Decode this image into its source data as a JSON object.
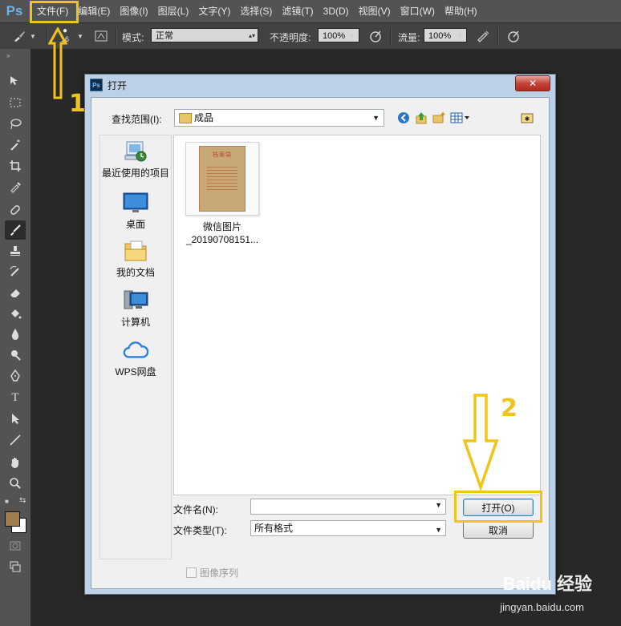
{
  "app": {
    "logo": "Ps"
  },
  "menu": [
    "文件(F)",
    "编辑(E)",
    "图像(I)",
    "图层(L)",
    "文字(Y)",
    "选择(S)",
    "滤镜(T)",
    "3D(D)",
    "视图(V)",
    "窗口(W)",
    "帮助(H)"
  ],
  "options": {
    "brush_size": "16",
    "mode_label": "模式:",
    "mode_value": "正常",
    "opacity_label": "不透明度:",
    "opacity_value": "100%",
    "flow_label": "流量:",
    "flow_value": "100%"
  },
  "colors": {
    "foreground": "#a07d4f",
    "background": "#ffffff",
    "highlight": "#f0c419"
  },
  "dialog": {
    "title": "打开",
    "close_symbol": "✕",
    "look_in_label": "查找范围(I):",
    "look_in_value": "成品",
    "places": [
      {
        "label": "最近使用的项目",
        "icon": "recent-items-icon"
      },
      {
        "label": "桌面",
        "icon": "desktop-icon"
      },
      {
        "label": "我的文档",
        "icon": "documents-icon"
      },
      {
        "label": "计算机",
        "icon": "computer-icon"
      },
      {
        "label": "WPS网盘",
        "icon": "cloud-icon"
      }
    ],
    "files": [
      {
        "name_line1": "微信图片",
        "name_line2": "_20190708151...",
        "thumb_title": "档案袋"
      }
    ],
    "filename_label": "文件名(N):",
    "filename_value": "",
    "filetype_label": "文件类型(T):",
    "filetype_value": "所有格式",
    "open_button": "打开(O)",
    "cancel_button": "取消",
    "image_sequence_label": "图像序列"
  },
  "annotations": {
    "step1": "1",
    "step2": "2"
  },
  "watermark": {
    "brand": "Baidu 经验",
    "url": "jingyan.baidu.com"
  }
}
